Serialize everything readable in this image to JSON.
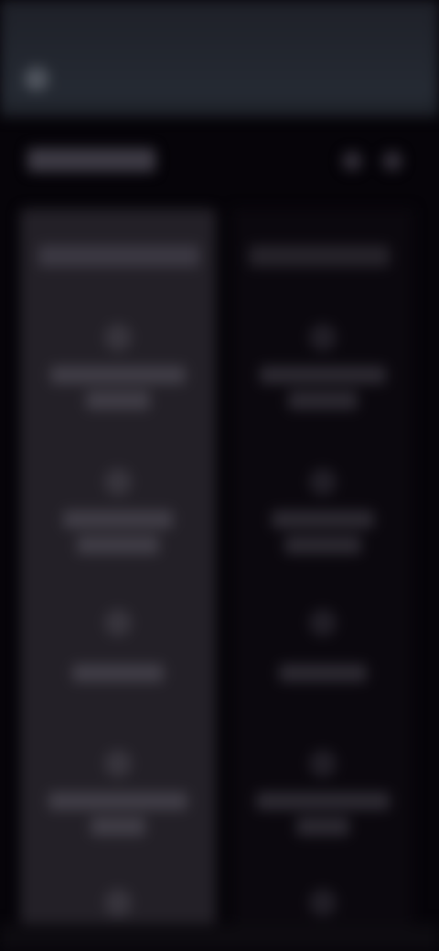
{
  "status_bar": {
    "time": "",
    "indicators": ""
  },
  "navigation": {
    "back_icon": "arrow-left-icon"
  },
  "header": {
    "title": "",
    "icons": [
      "search-icon",
      "more-icon"
    ]
  },
  "columns": [
    {
      "title": "",
      "items": [
        {
          "icon": "circle-icon",
          "label": ""
        },
        {
          "icon": "circle-icon",
          "label": ""
        },
        {
          "icon": "circle-icon",
          "label": ""
        },
        {
          "icon": "circle-icon",
          "label": ""
        },
        {
          "icon": "circle-icon",
          "label": ""
        }
      ]
    },
    {
      "title": "",
      "items": [
        {
          "icon": "circle-icon",
          "label": ""
        },
        {
          "icon": "circle-icon",
          "label": ""
        },
        {
          "icon": "circle-icon",
          "label": ""
        },
        {
          "icon": "circle-icon",
          "label": ""
        },
        {
          "icon": "circle-icon",
          "label": ""
        }
      ]
    }
  ],
  "colors": {
    "background": "#060409",
    "topbar": "#252a33",
    "left_column": "#232027",
    "right_column": "#0b080e"
  }
}
